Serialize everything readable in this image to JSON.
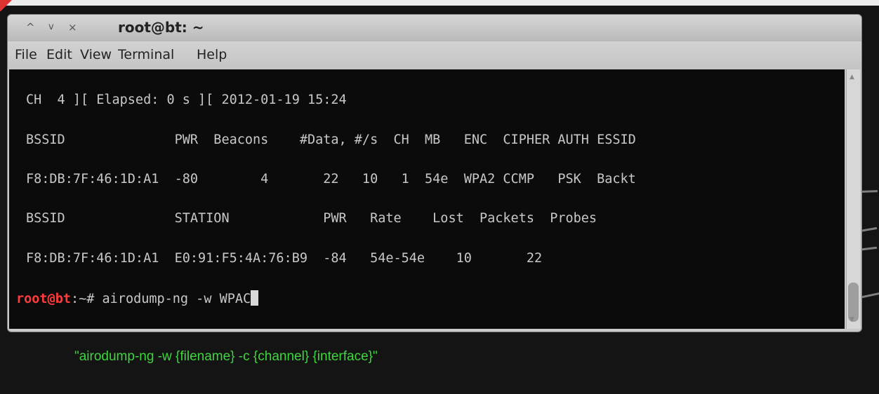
{
  "window": {
    "title": "root@bt: ~",
    "buttons": {
      "minimize_glyph": "^",
      "restore_glyph": "v",
      "close_glyph": "×"
    }
  },
  "menu": [
    {
      "label": "File"
    },
    {
      "label": "Edit"
    },
    {
      "label": "View"
    },
    {
      "label": "Terminal"
    },
    {
      "label": "Help"
    }
  ],
  "terminal": {
    "status_line": "CH  4 ][ Elapsed: 0 s ][ 2012-01-19 15:24",
    "ap_header": "BSSID              PWR  Beacons    #Data, #/s  CH  MB   ENC  CIPHER AUTH ESSID",
    "ap_row": "F8:DB:7F:46:1D:A1  -80        4       22   10   1  54e  WPA2 CCMP   PSK  Backt",
    "station_header": "BSSID              STATION            PWR   Rate    Lost  Packets  Probes",
    "station_row": "F8:DB:7F:46:1D:A1  E0:91:F5:4A:76:B9  -84   54e-54e    10       22",
    "prompt": {
      "user_host": "root@bt",
      "path_symbol": ":~#",
      "command": " airodump-ng -w WPAC"
    }
  },
  "caption": "\"airodump-ng -w {filename} -c {channel} {interface}\"",
  "colors": {
    "terminal_bg": "#0b0b0b",
    "terminal_text": "#c8c8c8",
    "prompt_user": "#ff3b3b",
    "caption": "#3ed63e"
  }
}
